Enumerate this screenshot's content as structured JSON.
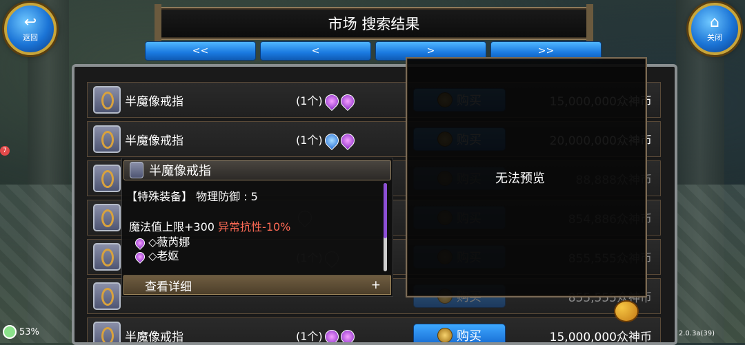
{
  "header": {
    "title": "市场 搜索结果",
    "back_label": "返回",
    "close_label": "关闭"
  },
  "pager": [
    "<<",
    "<",
    ">",
    ">>"
  ],
  "rows": [
    {
      "name": "半魔像戒指",
      "qty": "(1个)",
      "gems": [
        "purple",
        "purple"
      ],
      "buy": "购买",
      "price": "15,000,000众神币",
      "active": true
    },
    {
      "name": "半魔像戒指",
      "qty": "(1个)",
      "gems": [
        "blue",
        "purple"
      ],
      "buy": "购买",
      "price": "20,000,000众神币",
      "active": true
    },
    {
      "name": "",
      "qty": "",
      "gems": [],
      "buy": "购买",
      "price": "88,888众神币",
      "active": false
    },
    {
      "name": "",
      "qty": "",
      "gems": [
        "faint"
      ],
      "buy": "购买",
      "price": "854,886众神币",
      "active": false
    },
    {
      "name": "",
      "qty": "(1个)",
      "gems": [
        "faint"
      ],
      "buy": "购买",
      "price": "855,555众神币",
      "active": false
    },
    {
      "name": "",
      "qty": "",
      "gems": [],
      "buy": "购买",
      "price": "855,555众神币",
      "active": false
    },
    {
      "name": "半魔像戒指",
      "qty": "(1个)",
      "gems": [
        "purple",
        "purple"
      ],
      "buy": "购买",
      "price": "15,000,000众神币",
      "active": true
    }
  ],
  "preview": {
    "text": "无法预览"
  },
  "tooltip": {
    "name": "半魔像戒指",
    "line1": "【特殊装备】 物理防御 :  5",
    "line2a": "魔法值上限+300",
    "line2b": "异常抗性-10%",
    "line3": "◇薇芮娜",
    "line4": "◇老妪",
    "footer": "查看详细",
    "footer_plus": "+"
  },
  "status": {
    "battery": "53%",
    "version": "2.0.3a(39)",
    "badge": "7"
  }
}
